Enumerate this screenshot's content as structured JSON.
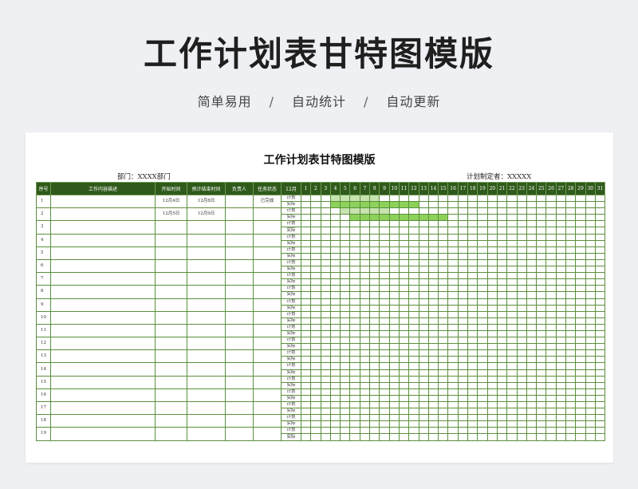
{
  "hero": {
    "title": "工作计划表甘特图模版",
    "tagline": [
      "简单易用",
      "自动统计",
      "自动更新"
    ],
    "separator": "/"
  },
  "sheet": {
    "title": "工作计划表甘特图模版",
    "department_label": "部门：XXXX部门",
    "planner_label": "计划制定者：XXXXX",
    "headers": {
      "index": "序号",
      "description": "工作内容描述",
      "start": "开始时间",
      "end": "预计结束时间",
      "owner": "负责人",
      "status": "任务状态",
      "month": "12月"
    },
    "plan_label": "计划",
    "actual_label": "实际",
    "days": [
      1,
      2,
      3,
      4,
      5,
      6,
      7,
      8,
      9,
      10,
      11,
      12,
      13,
      14,
      15,
      16,
      17,
      18,
      19,
      20,
      21,
      22,
      23,
      24,
      25,
      26,
      27,
      28,
      29,
      30,
      31
    ],
    "rows": [
      {
        "index": "1",
        "description": "",
        "start": "12月4日",
        "end": "12月8日",
        "owner": "",
        "status": "已完成",
        "plan_days": [
          4,
          8
        ],
        "actual_days": [
          4,
          12
        ]
      },
      {
        "index": "2",
        "description": "",
        "start": "12月5日",
        "end": "12月9日",
        "owner": "",
        "status": "",
        "plan_days": [
          5,
          9
        ],
        "actual_days": [
          6,
          15
        ]
      },
      {
        "index": "3",
        "description": "",
        "start": "",
        "end": "",
        "owner": "",
        "status": "",
        "plan_days": null,
        "actual_days": null
      },
      {
        "index": "4",
        "description": "",
        "start": "",
        "end": "",
        "owner": "",
        "status": "",
        "plan_days": null,
        "actual_days": null
      },
      {
        "index": "5",
        "description": "",
        "start": "",
        "end": "",
        "owner": "",
        "status": "",
        "plan_days": null,
        "actual_days": null
      },
      {
        "index": "6",
        "description": "",
        "start": "",
        "end": "",
        "owner": "",
        "status": "",
        "plan_days": null,
        "actual_days": null
      },
      {
        "index": "7",
        "description": "",
        "start": "",
        "end": "",
        "owner": "",
        "status": "",
        "plan_days": null,
        "actual_days": null
      },
      {
        "index": "8",
        "description": "",
        "start": "",
        "end": "",
        "owner": "",
        "status": "",
        "plan_days": null,
        "actual_days": null
      },
      {
        "index": "9",
        "description": "",
        "start": "",
        "end": "",
        "owner": "",
        "status": "",
        "plan_days": null,
        "actual_days": null
      },
      {
        "index": "10",
        "description": "",
        "start": "",
        "end": "",
        "owner": "",
        "status": "",
        "plan_days": null,
        "actual_days": null
      },
      {
        "index": "11",
        "description": "",
        "start": "",
        "end": "",
        "owner": "",
        "status": "",
        "plan_days": null,
        "actual_days": null
      },
      {
        "index": "12",
        "description": "",
        "start": "",
        "end": "",
        "owner": "",
        "status": "",
        "plan_days": null,
        "actual_days": null
      },
      {
        "index": "13",
        "description": "",
        "start": "",
        "end": "",
        "owner": "",
        "status": "",
        "plan_days": null,
        "actual_days": null
      },
      {
        "index": "14",
        "description": "",
        "start": "",
        "end": "",
        "owner": "",
        "status": "",
        "plan_days": null,
        "actual_days": null
      },
      {
        "index": "15",
        "description": "",
        "start": "",
        "end": "",
        "owner": "",
        "status": "",
        "plan_days": null,
        "actual_days": null
      },
      {
        "index": "16",
        "description": "",
        "start": "",
        "end": "",
        "owner": "",
        "status": "",
        "plan_days": null,
        "actual_days": null
      },
      {
        "index": "17",
        "description": "",
        "start": "",
        "end": "",
        "owner": "",
        "status": "",
        "plan_days": null,
        "actual_days": null
      },
      {
        "index": "18",
        "description": "",
        "start": "",
        "end": "",
        "owner": "",
        "status": "",
        "plan_days": null,
        "actual_days": null
      },
      {
        "index": "19",
        "description": "",
        "start": "",
        "end": "",
        "owner": "",
        "status": "",
        "plan_days": null,
        "actual_days": null
      }
    ]
  },
  "colors": {
    "header_bg": "#2f5a1b",
    "grid": "#5c8f3e",
    "plan_bar": "#c7e3b0",
    "actual_bar": "#8dd15a"
  }
}
